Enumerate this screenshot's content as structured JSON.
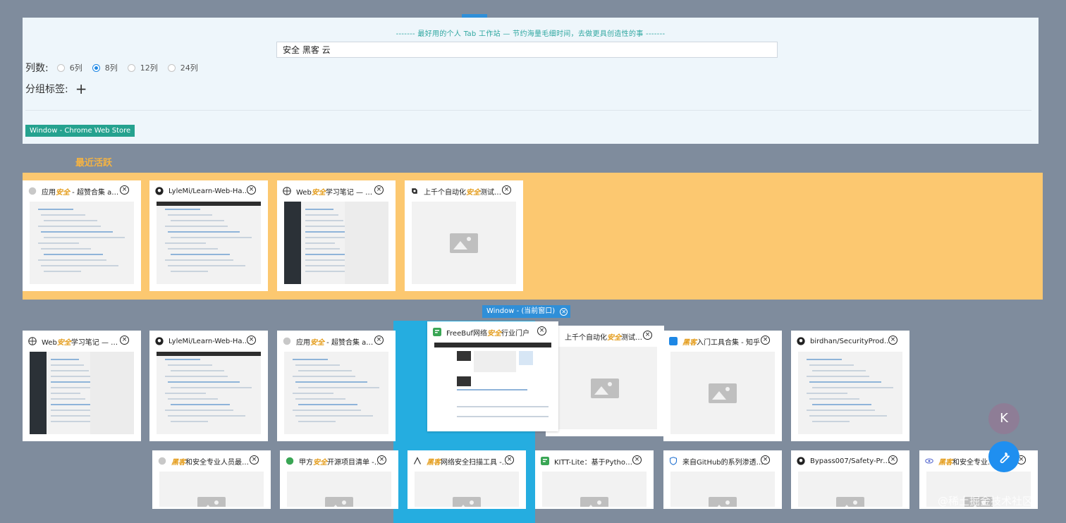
{
  "header": {
    "slogan": "------- 最好用的个人 Tab 工作站 — 节约海量毛细时间，去做更具创造性的事 -------",
    "search_value": "安全 黑客 云",
    "columns_label": "列数:",
    "column_options": [
      {
        "label": "6列",
        "checked": false
      },
      {
        "label": "8列",
        "checked": true
      },
      {
        "label": "12列",
        "checked": false
      },
      {
        "label": "24列",
        "checked": false
      }
    ],
    "group_label": "分组标签:",
    "add_group_symbol": "+",
    "window_tag": "Window - Chrome Web Store"
  },
  "recent": {
    "label": "最近活跃",
    "tabs": [
      {
        "favicon": "gray-circle-icon",
        "pre": "应用",
        "hl": "安全",
        "post": " - 超赞合集 awes..."
      },
      {
        "favicon": "github-icon",
        "pre": "LyleMi/Learn-Web-Hacki...",
        "hl": "",
        "post": ""
      },
      {
        "favicon": "globe-icon",
        "pre": "Web",
        "hl": "安全",
        "post": "学习笔记 — Web..."
      },
      {
        "favicon": "diamond-icon",
        "pre": "上千个自动化",
        "hl": "安全",
        "post": "测试工具..."
      }
    ]
  },
  "current_window": {
    "label": "Window - (当前窗口)",
    "close_symbol": "✕",
    "row1": [
      {
        "favicon": "globe-icon",
        "pre": "Web",
        "hl": "安全",
        "post": "学习笔记 — Web..."
      },
      {
        "favicon": "github-icon",
        "pre": "LyleMi/Learn-Web-Hacki...",
        "hl": "",
        "post": ""
      },
      {
        "favicon": "gray-circle-icon",
        "pre": "应用",
        "hl": "安全",
        "post": " - 超赞合集 awes..."
      },
      {
        "favicon": "diamond-icon",
        "pre": "上千个自动化",
        "hl": "安全",
        "post": "测试工具..."
      },
      {
        "favicon": "zhihu-icon",
        "pre": "",
        "hl": "黑客",
        "post": "入门工具合集 - 知乎"
      },
      {
        "favicon": "github-icon",
        "pre": "birdhan/SecurityProduct...",
        "hl": "",
        "post": ""
      }
    ],
    "dragging": {
      "favicon": "freebuf-icon",
      "pre": "FreeBuf网络",
      "hl": "安全",
      "post": "行业门户"
    },
    "row2": [
      {
        "favicon": "gray-circle-icon",
        "pre": "",
        "hl": "黑客",
        "post": "和安全专业人员最重..."
      },
      {
        "favicon": "green-circle-icon",
        "pre": "甲方",
        "hl": "安全",
        "post": "开源项目清单 - ..."
      },
      {
        "favicon": "radar-icon",
        "pre": "",
        "hl": "黑客",
        "post": "网络安全扫描工具 -..."
      },
      {
        "favicon": "freebuf-icon",
        "pre": "KITT-Lite：基于Python实...",
        "hl": "",
        "post": ""
      },
      {
        "favicon": "shield-icon",
        "pre": "来自GitHub的系列渗透测...",
        "hl": "",
        "post": ""
      },
      {
        "favicon": "github-icon",
        "pre": "Bypass007/Safety-Proje...",
        "hl": "",
        "post": ""
      },
      {
        "favicon": "eye-icon",
        "pre": "",
        "hl": "黑客",
        "post": "和安全专业..."
      }
    ]
  },
  "avatar_initial": "K",
  "watermark": "@稀土掘金技术社区",
  "colors": {
    "background": "#7f8c9d",
    "recent_strip": "#fcc870",
    "highlight": "#e39a16",
    "accent": "#2f8fd8",
    "tag_green": "#25a28f"
  }
}
